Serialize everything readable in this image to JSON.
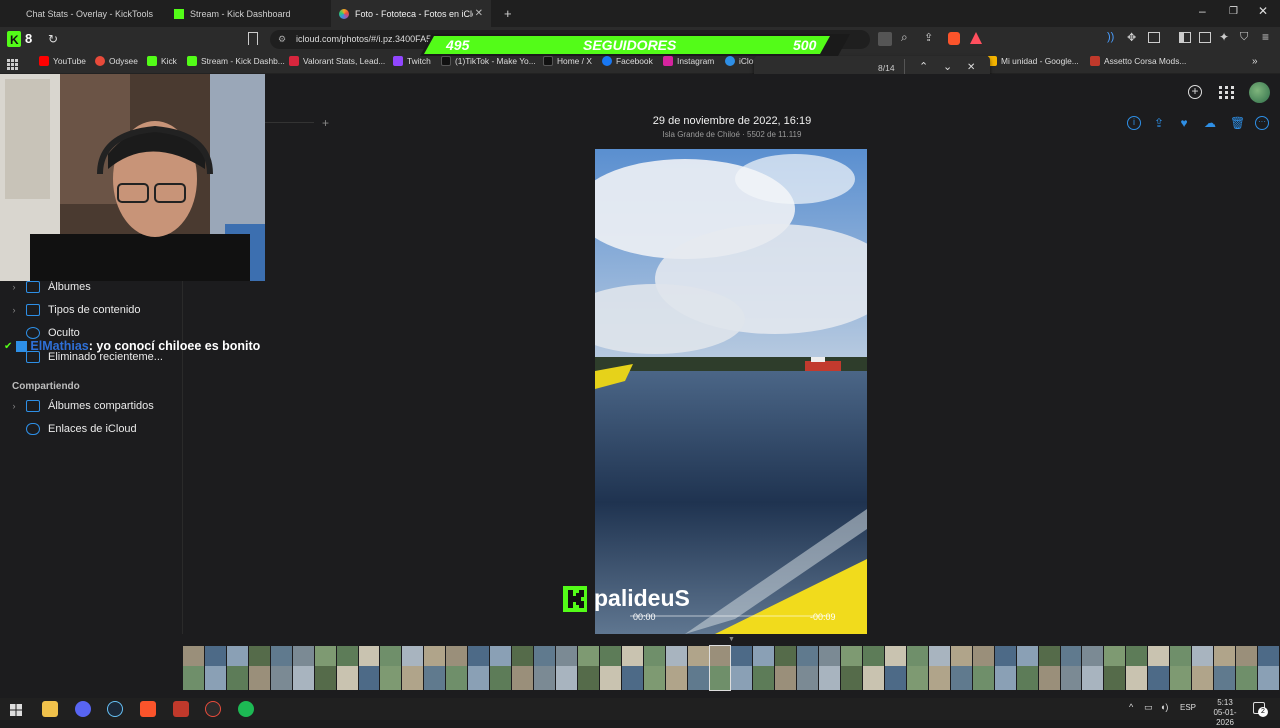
{
  "tabs": [
    {
      "title": "Chat Stats - Overlay - KickTools"
    },
    {
      "title": "Stream - Kick Dashboard"
    },
    {
      "title": "Foto - Fototeca - Fotos en iCloud"
    }
  ],
  "address": {
    "url": "icloud.com/photos/#/i.pz.3400FA5",
    "ext_badge": "8"
  },
  "bookmarks": [
    {
      "label": "YouTube",
      "color": "#ff0000"
    },
    {
      "label": "Odysee",
      "color": "#e84a3a"
    },
    {
      "label": "Kick",
      "color": "#53fc18"
    },
    {
      "label": "Stream - Kick Dashb...",
      "color": "#53fc18"
    },
    {
      "label": "Valorant Stats, Lead...",
      "color": "#d7263d"
    },
    {
      "label": "Twitch",
      "color": "#9146ff"
    },
    {
      "label": "(1)TikTok - Make Yo...",
      "color": "#111111"
    },
    {
      "label": "Home / X",
      "color": "#111111"
    },
    {
      "label": "Facebook",
      "color": "#1877f2"
    },
    {
      "label": "Instagram",
      "color": "#d6249f"
    },
    {
      "label": "iClou",
      "color": "#2e8fe6"
    },
    {
      "label": "Mi unidad - Google...",
      "color": "#f4b400"
    },
    {
      "label": "Assetto Corsa Mods...",
      "color": "#c0392b"
    }
  ],
  "find": {
    "count": "8/14"
  },
  "followers": {
    "current": "495",
    "label": "SEGUIDORES",
    "goal": "500",
    "progress": 0.99
  },
  "sidebar": {
    "items": [
      {
        "label": "Álbumes"
      },
      {
        "label": "Tipos de contenido"
      },
      {
        "label": "Oculto"
      },
      {
        "label": "Eliminado recienteme..."
      }
    ],
    "shared_section": "Compartiendo",
    "shared_items": [
      {
        "label": "Álbumes compartidos"
      },
      {
        "label": "Enlaces de iCloud"
      }
    ]
  },
  "photo": {
    "date": "29 de noviembre de 2022, 16:19",
    "location": "Isla Grande de Chiloé · 5502 de 11.119",
    "time_elapsed": "00:00",
    "time_remaining": "-00:09"
  },
  "chat": {
    "user": "ElMathias",
    "message": ": yo conocí chiloee es bonito"
  },
  "streamer": {
    "name": "palideuS"
  },
  "taskbar": {
    "lang": "ESP",
    "time": "5:13",
    "date": "05-01-2026",
    "notif": "2"
  }
}
